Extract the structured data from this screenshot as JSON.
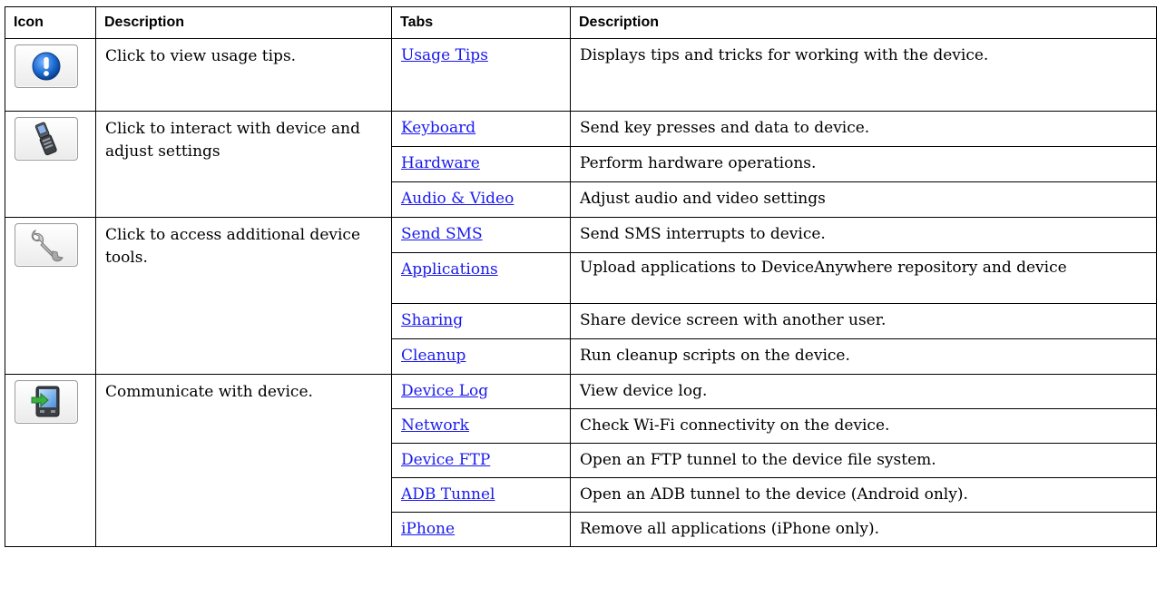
{
  "header": {
    "icon": "Icon",
    "description": "Description",
    "tabs": "Tabs",
    "tab_description": "Description"
  },
  "groups": [
    {
      "icon": "info-icon",
      "description": "Click to view usage tips.",
      "tabs": [
        {
          "label": "Usage Tips",
          "description": "Displays tips and tricks for working with the device."
        }
      ]
    },
    {
      "icon": "phone-icon",
      "description": "Click to interact with device and adjust settings",
      "tabs": [
        {
          "label": "Keyboard",
          "description": "Send key presses and data to device."
        },
        {
          "label": "Hardware",
          "description": "Perform hardware operations."
        },
        {
          "label": "Audio & Video",
          "description": "Adjust audio and video settings"
        }
      ]
    },
    {
      "icon": "wrench-icon",
      "description": "Click to access additional device tools.",
      "tabs": [
        {
          "label": "Send SMS",
          "description": "Send SMS interrupts to device."
        },
        {
          "label": "Applications",
          "description": "Upload applications to DeviceAnywhere repository and device"
        },
        {
          "label": "Sharing",
          "description": "Share device screen with another user."
        },
        {
          "label": "Cleanup",
          "description": "Run cleanup scripts on the device."
        }
      ]
    },
    {
      "icon": "device-transfer-icon",
      "description": "Communicate with device.",
      "tabs": [
        {
          "label": "Device Log",
          "description": "View device log."
        },
        {
          "label": "Network",
          "description": "Check Wi-Fi connectivity on the device."
        },
        {
          "label": "Device FTP",
          "description": "Open an FTP tunnel to the device file system."
        },
        {
          "label": "ADB Tunnel",
          "description": "Open an ADB tunnel to the device (Android only)."
        },
        {
          "label": "iPhone",
          "description": "Remove all applications (iPhone only)."
        }
      ]
    }
  ],
  "colors": {
    "link": "#1a1aee",
    "border": "#000000",
    "info_blue": "#1f6fd6"
  }
}
